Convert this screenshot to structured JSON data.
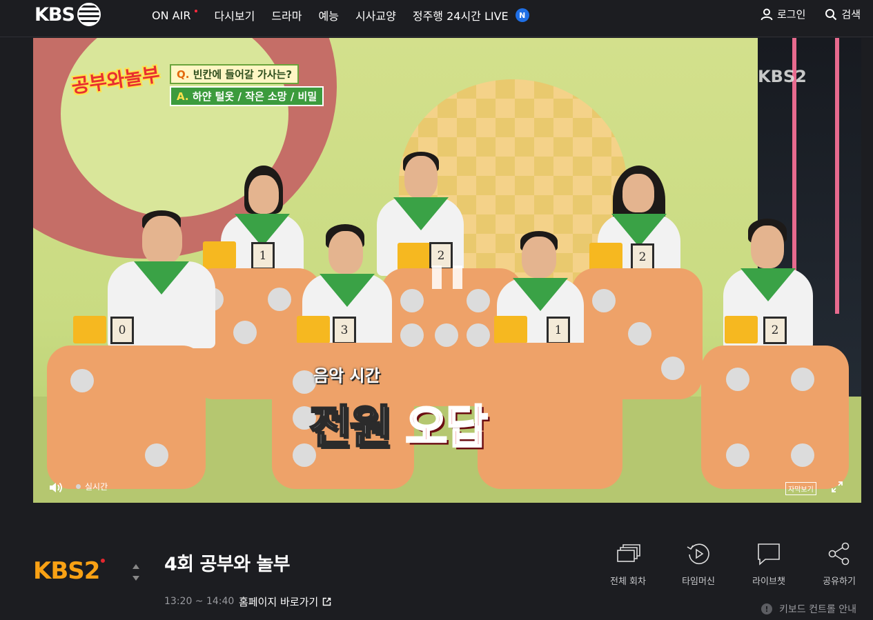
{
  "header": {
    "logo_text": "KBS",
    "nav": [
      {
        "label": "ON AIR",
        "live_dot": true
      },
      {
        "label": "다시보기"
      },
      {
        "label": "드라마"
      },
      {
        "label": "예능"
      },
      {
        "label": "시사교양"
      },
      {
        "label": "정주행 24시간 LIVE",
        "badge": "N"
      }
    ],
    "login_label": "로그인",
    "search_label": "검색"
  },
  "player": {
    "show_logo": "공부와놀부",
    "quiz_q_mark": "Q.",
    "quiz_question": "빈칸에 들어갈 가사는?",
    "quiz_a_mark": "A.",
    "quiz_answer": "하얀 털옷 / 작은 소망 / 비밀",
    "channel_bug": "KBS2",
    "caption_sub": "음악 시간",
    "caption_main_white": "전원",
    "caption_main_red": "오답",
    "scores": [
      "1",
      "2",
      "2",
      "0",
      "3",
      "1",
      "2"
    ],
    "live_label": "실시간",
    "subtitle_label": "자막보기",
    "state": "paused"
  },
  "program": {
    "channel_logo": "KBS2",
    "title": "4회 공부와 놀부",
    "time": "13:20 ~ 14:40",
    "homepage_label": "홈페이지 바로가기"
  },
  "actions": [
    {
      "label": "전체 회차",
      "icon": "episodes-icon"
    },
    {
      "label": "타임머신",
      "icon": "timemachine-icon"
    },
    {
      "label": "라이브챗",
      "icon": "chat-icon"
    },
    {
      "label": "공유하기",
      "icon": "share-icon"
    }
  ],
  "keyboard_guide": "키보드 컨트롤 안내",
  "colors": {
    "background": "#1c1d21",
    "accent_red": "#ff2a3d",
    "badge_blue": "#1f6fe5",
    "kbs2_orange": "#f8a114"
  }
}
